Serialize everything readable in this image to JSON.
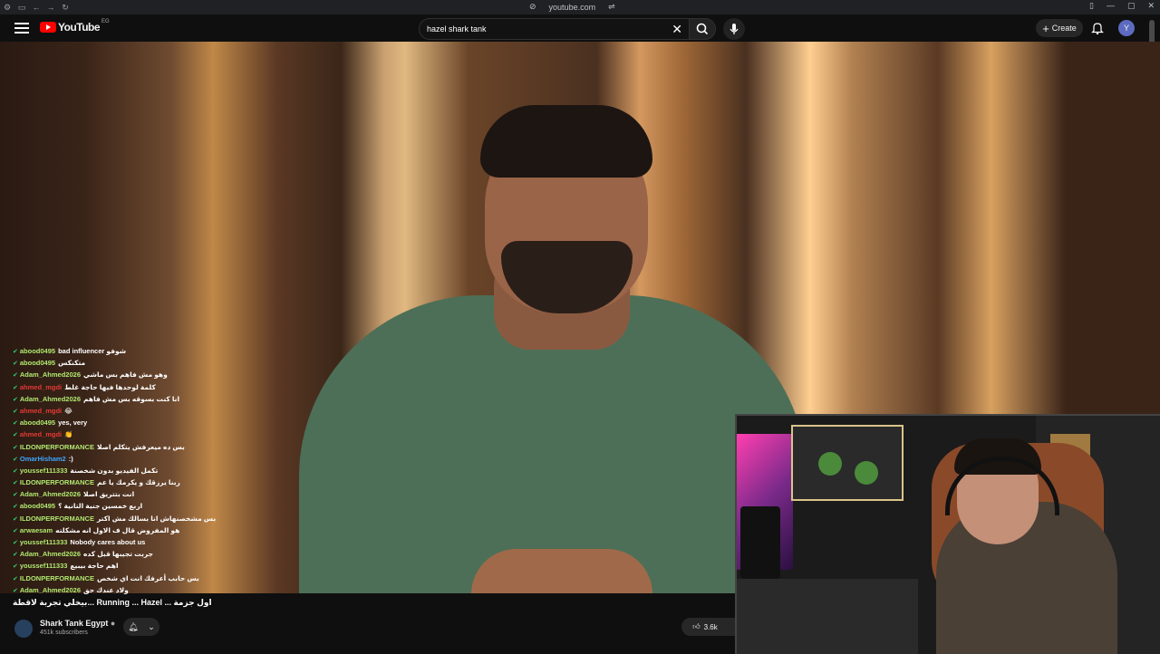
{
  "browser": {
    "url": "youtube.com"
  },
  "header": {
    "logo_text": "YouTube",
    "country_code": "EG",
    "search_value": "hazel shark tank",
    "create_label": "Create",
    "avatar_letter": "Y"
  },
  "chat": [
    {
      "user": "abood0495",
      "msg": "bad influencer شوفو",
      "color": "#b0e870"
    },
    {
      "user": "abood0495",
      "msg": "متكنكس",
      "color": "#b0e870"
    },
    {
      "user": "Adam_Ahmed2026",
      "msg": "وهو مش فاهم بس ماشي",
      "color": "#b0e870"
    },
    {
      "user": "ahmed_mgdi",
      "msg": "كلمة لوحدها فيها حاجة غلط",
      "color": "#e53935"
    },
    {
      "user": "Adam_Ahmed2026",
      "msg": "انا كنت بسوقه بس مش فاهم",
      "color": "#b0e870"
    },
    {
      "user": "ahmed_mgdi",
      "msg": "😂",
      "color": "#e53935"
    },
    {
      "user": "abood0495",
      "msg": "yes, very",
      "color": "#b0e870"
    },
    {
      "user": "ahmed_mgdi",
      "msg": "👏",
      "color": "#e53935"
    },
    {
      "user": "ILDONPERFORMANCE",
      "msg": "بس ده ميعرفش يتكلم اصلا",
      "color": "#b0e870"
    },
    {
      "user": "OmarHisham2",
      "msg": ":)",
      "color": "#3ea6ff"
    },
    {
      "user": "youssef111333",
      "msg": "تكمل الفيديو بدون شخصنة",
      "color": "#b0e870"
    },
    {
      "user": "ILDONPERFORMANCE",
      "msg": "ربنا يرزقك و يكرمك يا عم",
      "color": "#b0e870"
    },
    {
      "user": "Adam_Ahmed2026",
      "msg": "انت بتتريق اصلا",
      "color": "#b0e870"
    },
    {
      "user": "abood0495",
      "msg": "اربع خمسين جنية التانية ؟",
      "color": "#b0e870"
    },
    {
      "user": "ILDONPERFORMANCE",
      "msg": "بس مشخصنهاش انا بسالك مش اكتر",
      "color": "#b0e870"
    },
    {
      "user": "arwaesam",
      "msg": "هو المفروض قال ف الاول انه مشكلته",
      "color": "#b0e870"
    },
    {
      "user": "youssef111333",
      "msg": "Nobody cares about us",
      "color": "#b0e870"
    },
    {
      "user": "Adam_Ahmed2026",
      "msg": "جربت تجيبها قبل كده",
      "color": "#b0e870"
    },
    {
      "user": "youssef111333",
      "msg": "اهم حاجة بيبيع",
      "color": "#b0e870"
    },
    {
      "user": "ILDONPERFORMANCE",
      "msg": "بس حابب أعرفك انت اي شخص",
      "color": "#b0e870"
    },
    {
      "user": "Adam_Ahmed2026",
      "msg": "ولاد عندك حق",
      "color": "#b0e870"
    }
  ],
  "subtitle": "بيخلي تجربة لاقطة... Running ... Hazel ... اول جزمة",
  "channel": {
    "name": "Shark Tank Egypt",
    "subscribers": "451k subscribers",
    "likes": "3.6k"
  },
  "colors": {
    "background": "#0f0f0f",
    "accent": "#ff0000",
    "verified": "#2ecc71"
  },
  "icons": [
    "menu-icon",
    "search-icon",
    "mic-icon",
    "bell-icon",
    "plus-icon",
    "like-icon",
    "close-icon"
  ]
}
